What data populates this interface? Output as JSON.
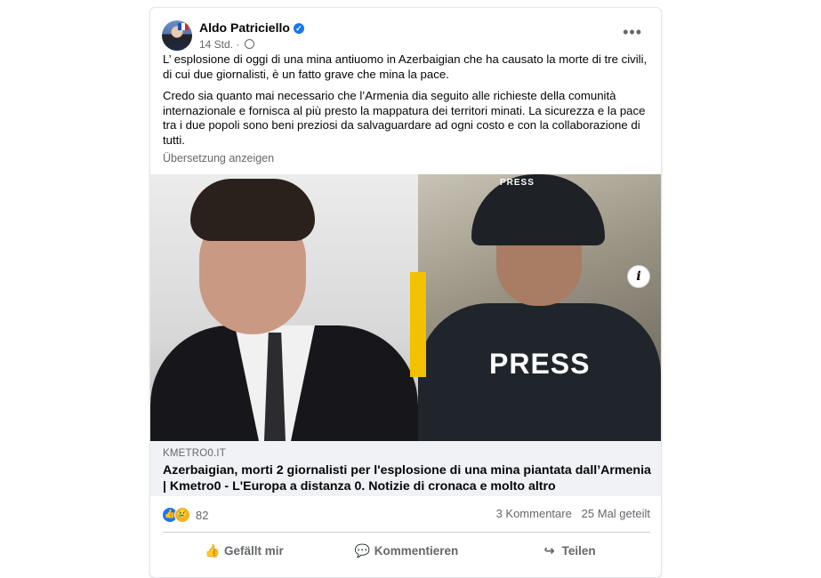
{
  "post": {
    "author": "Aldo Patriciello",
    "time": "14 Std.",
    "meta_sep": "·",
    "paragraph1": "L’ esplosione di oggi di una mina antiuomo in Azerbaigian che ha causato la morte di tre civili, di cui due giornalisti, è un fatto grave che mina la pace.",
    "paragraph2": "Credo sia quanto mai necessario che l’Armenia dia seguito alle richieste della comunità internazionale e fornisca al più presto la mappatura dei territori minati. La sicurezza e la pace tra i due popoli sono beni preziosi da salvaguardare ad ogni costo e con la collaborazione di tutti.",
    "translate_label": "Übersetzung anzeigen",
    "more_label": "•••"
  },
  "image": {
    "helmet_text": "PRESS",
    "vest_text": "PRESS",
    "info_label": "i"
  },
  "link": {
    "domain": "KMETRO0.IT",
    "headline": "Azerbaigian, morti 2 giornalisti per l'esplosione di una mina piantata dall’Armenia | Kmetro0 - L'Europa a distanza 0. Notizie di cronaca e molto altro"
  },
  "stats": {
    "reactions_count": "82",
    "comments": "3 Kommentare",
    "shares": "25 Mal geteilt"
  },
  "actions": {
    "like": "Gefällt mir",
    "comment": "Kommentieren",
    "share": "Teilen"
  },
  "icons": {
    "like": "👍",
    "sad": "😢",
    "verified": "✓",
    "comment": "💬",
    "share": "↪"
  },
  "colors": {
    "accent": "#1877f2",
    "secondary_text": "#65676b",
    "divider_bar": "#f2c100"
  }
}
